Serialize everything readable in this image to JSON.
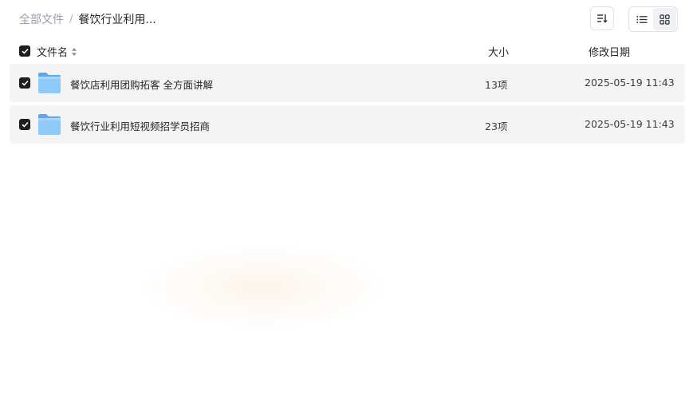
{
  "breadcrumb": {
    "root": "全部文件",
    "separator": "/",
    "current": "餐饮行业利用..."
  },
  "toolbar": {
    "sort_icon": "sort-list-icon",
    "list_view_icon": "list-view-icon",
    "grid_view_icon": "grid-view-icon",
    "active_view": "list"
  },
  "table": {
    "headers": {
      "name": "文件名",
      "size": "大小",
      "date": "修改日期"
    },
    "all_selected": true,
    "rows": [
      {
        "name": "餐饮店利用团购拓客 全方面讲解",
        "count": "13项",
        "date": "2025-05-19 11:43",
        "selected": true,
        "icon": "folder-icon"
      },
      {
        "name": "餐饮行业利用短视频招学员招商",
        "count": "23项",
        "date": "2025-05-19 11:43",
        "selected": true,
        "icon": "folder-icon"
      }
    ]
  },
  "colors": {
    "row_bg": "#f4f4f5",
    "checkbox": "#1c1d21",
    "folder_light": "#8ec9f7",
    "folder_dark": "#5aa9ef"
  }
}
